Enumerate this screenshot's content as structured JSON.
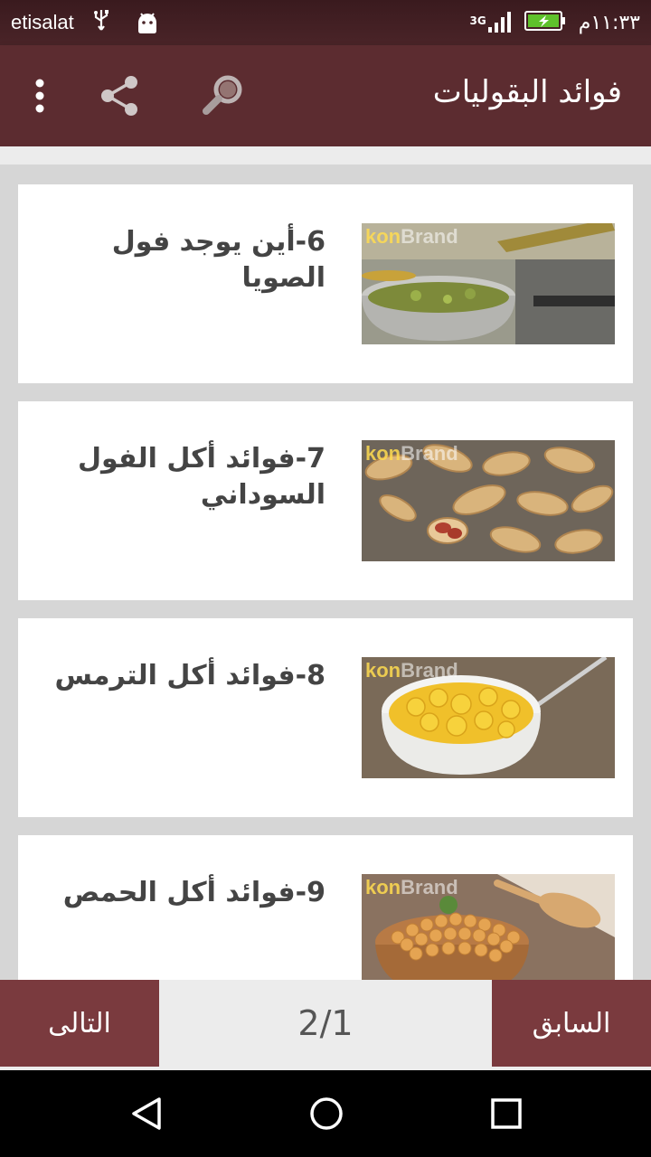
{
  "status": {
    "carrier": "etisalat",
    "network": "3G",
    "time": "١١:٣٣م"
  },
  "appbar": {
    "title": "فوائد البقوليات",
    "icons": [
      "search-icon",
      "share-icon",
      "overflow-menu-icon"
    ]
  },
  "items": [
    {
      "title": "6-أين يوجد فول الصويا",
      "image": "pan-on-stove",
      "watermark": "konBrand"
    },
    {
      "title": "7-فوائد أكل الفول السوداني",
      "image": "peanuts",
      "watermark": "konBrand"
    },
    {
      "title": "8-فوائد أكل الترمس",
      "image": "lupini-beans-bowl",
      "watermark": "konBrand"
    },
    {
      "title": "9-فوائد أكل الحمص",
      "image": "chickpeas-bowl",
      "watermark": "konBrand"
    }
  ],
  "pager": {
    "next_label": "التالى",
    "page_indicator": "2/1",
    "prev_label": "السابق"
  },
  "colors": {
    "appbar": "#5c2c30",
    "button": "#7a3a3e",
    "statusbar": "#4a2428"
  }
}
